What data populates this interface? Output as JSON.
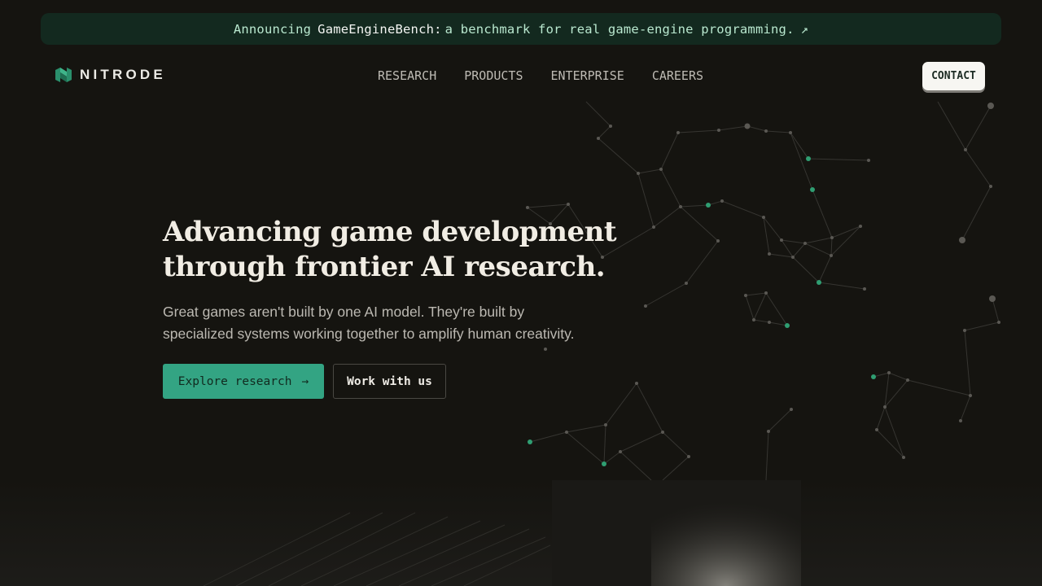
{
  "announcement": {
    "prefix": "Announcing",
    "highlight": "GameEngineBench:",
    "rest": "a benchmark for real game-engine programming.",
    "arrow": "↗"
  },
  "brand": {
    "name": "NITRODE",
    "logo_icon": "nitrode-logo-icon"
  },
  "nav": {
    "items": [
      {
        "label": "RESEARCH"
      },
      {
        "label": "PRODUCTS"
      },
      {
        "label": "ENTERPRISE"
      },
      {
        "label": "CAREERS"
      }
    ]
  },
  "contact": {
    "label": "CONTACT"
  },
  "hero": {
    "title_line1": "Advancing game development",
    "title_line2": "through frontier AI research.",
    "subtitle_line1": "Great games aren't built by one AI model. They're built by",
    "subtitle_line2": "specialized systems working together to amplify human creativity.",
    "primary_label": "Explore research",
    "primary_arrow": "→",
    "secondary_label": "Work with us"
  },
  "colors": {
    "background": "#151410",
    "accent": "#33a483",
    "announcement_bg": "#13291f",
    "node_green": "#2f9e72",
    "node_gray": "#5a5853"
  }
}
